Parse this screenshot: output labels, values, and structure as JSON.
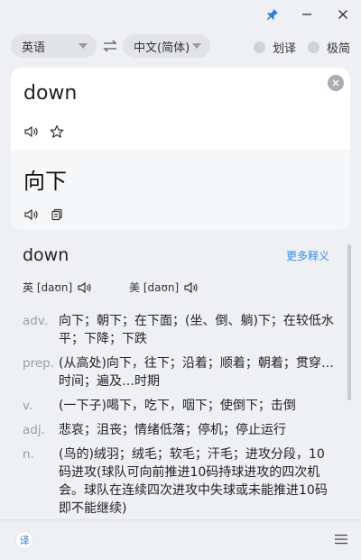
{
  "titlebar": {
    "icons": [
      "pin-icon",
      "minimize-icon",
      "close-icon"
    ],
    "pin_color": "#2f7de1"
  },
  "languages": {
    "source": "英语",
    "target": "中文(简体)",
    "swap_icon": "swap-icon"
  },
  "toggles": {
    "selection_translate": "划译",
    "minimal": "极简"
  },
  "input": {
    "source_text": "down",
    "translated_text": "向下"
  },
  "dictionary": {
    "word": "down",
    "more_label": "更多释义",
    "uk_phonetic": "英 [daʊn]",
    "us_phonetic": "美 [daʊn]",
    "definitions": [
      {
        "pos": "adv.",
        "text": "向下；朝下；在下面；(坐、倒、躺)下；在较低水平；下降；下跌"
      },
      {
        "pos": "prep.",
        "text": "(从高处)向下，往下；沿着；顺着；朝着；贯穿…时间；遍及…时期"
      },
      {
        "pos": "v.",
        "text": "(一下子)喝下，吃下，咽下；使倒下；击倒"
      },
      {
        "pos": "adj.",
        "text": "悲哀；沮丧；情绪低落；停机；停止运行"
      },
      {
        "pos": "n.",
        "text": "(鸟的)绒羽；绒毛；软毛；汗毛；进攻分段，10码进攻(球队可向前推进10码持球进攻的四次机会。球队在连续四次进攻中失球或未能推进10码即不能继续)"
      }
    ]
  },
  "footer": {
    "logo_text": "译",
    "menu_icon": "hamburger-menu-icon"
  },
  "colors": {
    "accent": "#3a8ee6",
    "background": "#eef0f3"
  }
}
